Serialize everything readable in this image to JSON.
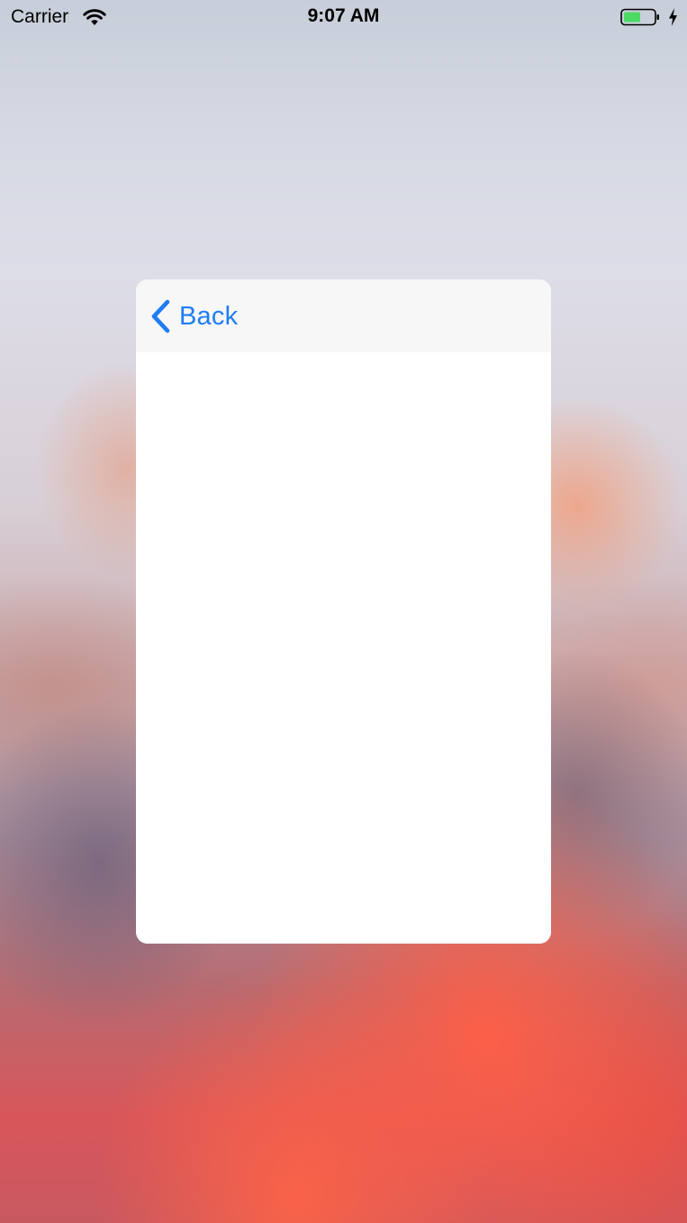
{
  "status_bar": {
    "carrier": "Carrier",
    "time": "9:07 AM",
    "battery_color": "#4cd964"
  },
  "nav": {
    "back_label": "Back",
    "accent_color": "#1f7df6"
  },
  "icons": {
    "wifi": "wifi-icon",
    "battery": "battery-icon",
    "charging": "charging-bolt-icon",
    "back": "chevron-left-icon"
  }
}
